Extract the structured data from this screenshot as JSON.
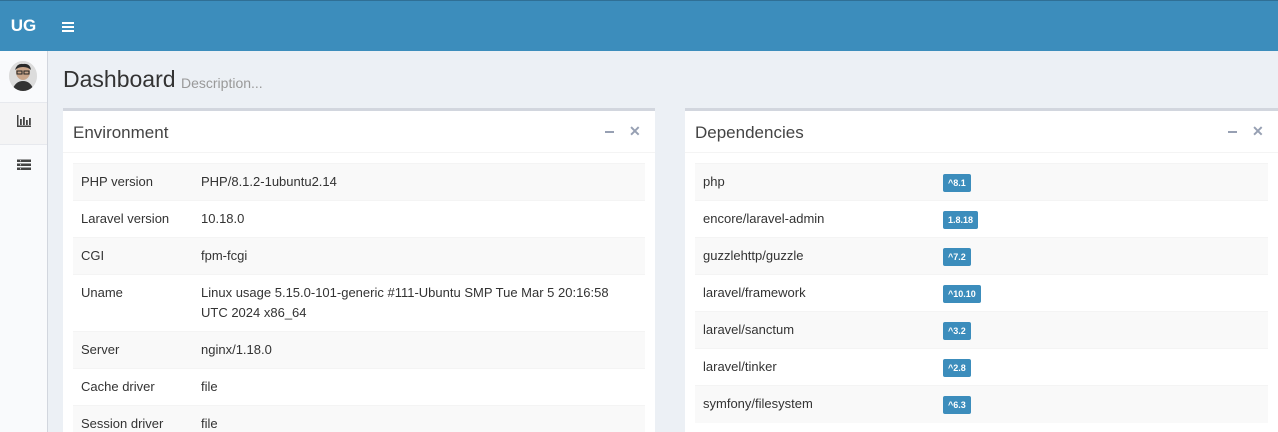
{
  "header": {
    "logo": "UG"
  },
  "page": {
    "title": "Dashboard",
    "description": "Description..."
  },
  "environment": {
    "title": "Environment",
    "rows": [
      {
        "key": "PHP version",
        "value": "PHP/8.1.2-1ubuntu2.14"
      },
      {
        "key": "Laravel version",
        "value": "10.18.0"
      },
      {
        "key": "CGI",
        "value": "fpm-fcgi"
      },
      {
        "key": "Uname",
        "value": "Linux usage 5.15.0-101-generic #111-Ubuntu SMP Tue Mar 5 20:16:58 UTC 2024 x86_64"
      },
      {
        "key": "Server",
        "value": "nginx/1.18.0"
      },
      {
        "key": "Cache driver",
        "value": "file"
      },
      {
        "key": "Session driver",
        "value": "file"
      }
    ]
  },
  "dependencies": {
    "title": "Dependencies",
    "rows": [
      {
        "key": "php",
        "value": "^8.1"
      },
      {
        "key": "encore/laravel-admin",
        "value": "1.8.18"
      },
      {
        "key": "guzzlehttp/guzzle",
        "value": "^7.2"
      },
      {
        "key": "laravel/framework",
        "value": "^10.10"
      },
      {
        "key": "laravel/sanctum",
        "value": "^3.2"
      },
      {
        "key": "laravel/tinker",
        "value": "^2.8"
      },
      {
        "key": "symfony/filesystem",
        "value": "^6.3"
      }
    ]
  },
  "icons": {
    "menu": "hamburger-menu-icon",
    "chart": "bar-chart-icon",
    "list": "list-icon",
    "minimize": "minus-icon",
    "close": "close-icon"
  },
  "colors": {
    "header": "#3c8dbc",
    "badge": "#3c8dbc"
  }
}
